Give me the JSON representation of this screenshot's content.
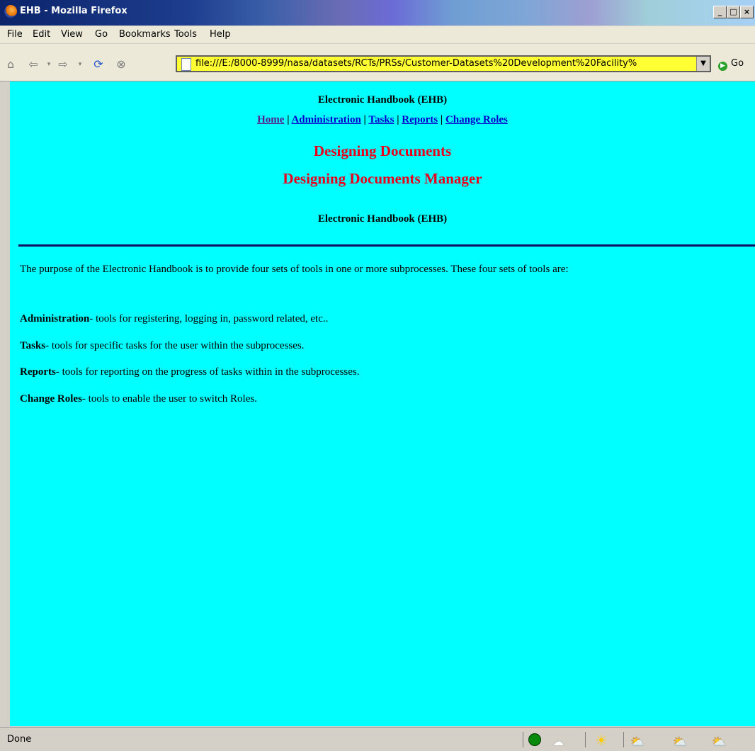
{
  "window": {
    "title": "EHB - Mozilla Firefox"
  },
  "menu": [
    "File",
    "Edit",
    "View",
    "Go",
    "Bookmarks",
    "Tools",
    "Help"
  ],
  "url": "file:///E:/8000-8999/nasa/datasets/RCTs/PRSs/Customer-Datasets%20Development%20Facility%",
  "go_label": "Go",
  "page": {
    "header": "Electronic Handbook (EHB)",
    "nav": [
      "Home",
      "Administration",
      "Tasks",
      "Reports",
      "Change Roles"
    ],
    "title": "Designing Documents",
    "subtitle": "Designing Documents Manager",
    "header2": "Electronic Handbook (EHB)",
    "intro": "The purpose of the Electronic Handbook is to provide four sets of tools  in one or more subprocesses.  These four sets of tools are:",
    "items": [
      {
        "term": "Administration",
        "desc": "- tools for registering, logging in, password related, etc.."
      },
      {
        "term": "Tasks",
        "desc": "- tools for specific tasks for the user within the subprocesses."
      },
      {
        "term": "Reports",
        "desc": "- tools for reporting on the progress of tasks within in the subprocesses."
      },
      {
        "term": "Change Roles",
        "desc": "- tools to enable the user to switch Roles."
      }
    ]
  },
  "status": "Done",
  "colors": {
    "background": "#00ffff",
    "heading": "#e8001c",
    "link": "#0000cc"
  }
}
